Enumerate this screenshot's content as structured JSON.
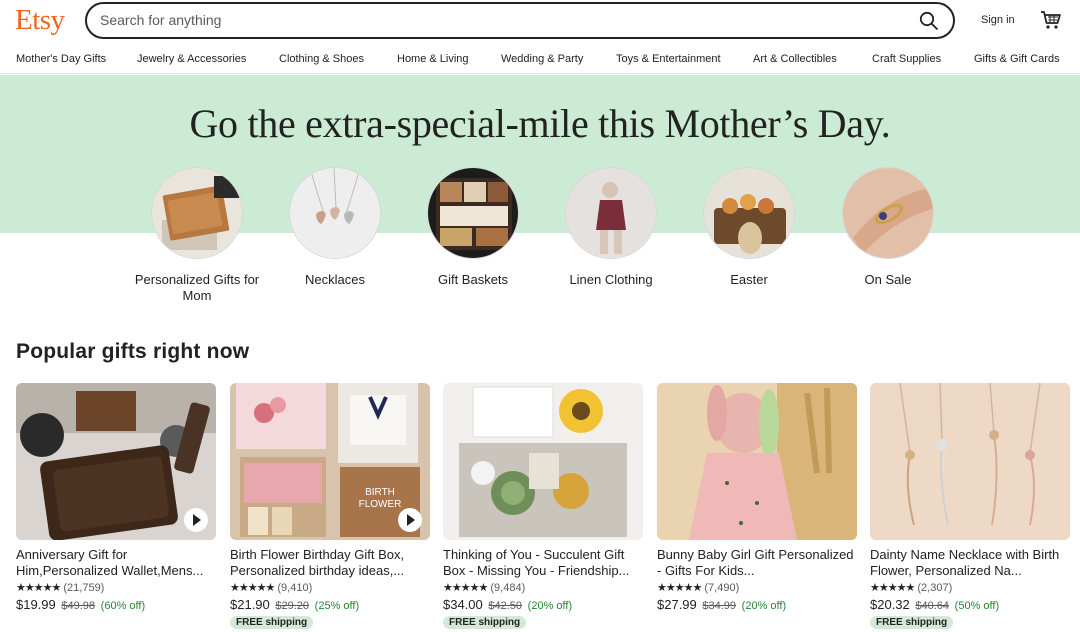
{
  "header": {
    "logo": "Etsy",
    "search_placeholder": "Search for anything",
    "sign_in": "Sign in"
  },
  "categories": [
    "Mother's Day Gifts",
    "Jewelry & Accessories",
    "Clothing & Shoes",
    "Home & Living",
    "Wedding & Party",
    "Toys & Entertainment",
    "Art & Collectibles",
    "Craft Supplies",
    "Gifts & Gift Cards"
  ],
  "hero": {
    "title": "Go the extra-special-mile this Mother’s Day.",
    "circles": [
      {
        "label": "Personalized Gifts for Mom"
      },
      {
        "label": "Necklaces"
      },
      {
        "label": "Gift Baskets"
      },
      {
        "label": "Linen Clothing"
      },
      {
        "label": "Easter"
      },
      {
        "label": "On Sale"
      }
    ]
  },
  "popular": {
    "title": "Popular gifts right now",
    "items": [
      {
        "title": "Anniversary Gift for Him,Personalized Wallet,Mens...",
        "stars": "★★★★★",
        "reviews": "(21,759)",
        "price": "$19.99",
        "orig": "$49.98",
        "discount": "(60% off)",
        "free_shipping": ""
      },
      {
        "title": "Birth Flower Birthday Gift Box, Personalized birthday ideas,...",
        "stars": "★★★★★",
        "reviews": "(9,410)",
        "price": "$21.90",
        "orig": "$29.20",
        "discount": "(25% off)",
        "free_shipping": "FREE shipping"
      },
      {
        "title": "Thinking of You - Succulent Gift Box - Missing You - Friendship...",
        "stars": "★★★★★",
        "reviews": "(9,484)",
        "price": "$34.00",
        "orig": "$42.50",
        "discount": "(20% off)",
        "free_shipping": "FREE shipping"
      },
      {
        "title": "Bunny Baby Girl Gift Personalized - Gifts For Kids...",
        "stars": "★★★★★",
        "reviews": "(7,490)",
        "price": "$27.99",
        "orig": "$34.99",
        "discount": "(20% off)",
        "free_shipping": ""
      },
      {
        "title": "Dainty Name Necklace with Birth Flower, Personalized Na...",
        "stars": "★★★★★",
        "reviews": "(2,307)",
        "price": "$20.32",
        "orig": "$40.64",
        "discount": "(50% off)",
        "free_shipping": "FREE shipping"
      }
    ]
  },
  "colors": {
    "brand": "#F1641E",
    "hero_bg": "#CCEBD4",
    "discount": "#258635",
    "free_shipping_bg": "#D4E9D7"
  },
  "icons": {
    "search": "search-icon",
    "cart": "cart-icon",
    "play": "play-icon"
  }
}
